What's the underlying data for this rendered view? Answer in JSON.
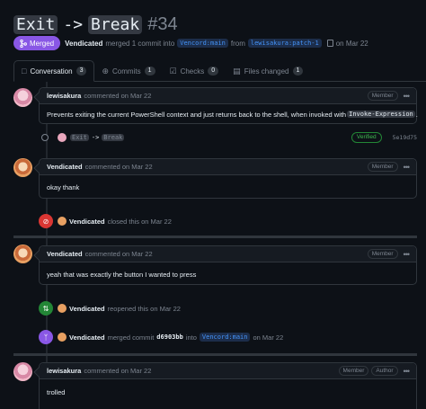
{
  "title": {
    "from": "Exit",
    "arrow": "->",
    "to": "Break",
    "number": "#34"
  },
  "state": {
    "badge": "Merged",
    "author": "Vendicated",
    "text1": "merged 1 commit into",
    "base": "Vencord:main",
    "text2": "from",
    "head": "lewisakura:patch-1",
    "date": "on Mar 22"
  },
  "tabs": [
    {
      "label": "Conversation",
      "count": "3",
      "icon": "comment-icon"
    },
    {
      "label": "Commits",
      "count": "1",
      "icon": "commit-icon"
    },
    {
      "label": "Checks",
      "count": "0",
      "icon": "checks-icon"
    },
    {
      "label": "Files changed",
      "count": "1",
      "icon": "file-diff-icon"
    }
  ],
  "comments": [
    {
      "author": "lewisakura",
      "meta": "commented on Mar 22",
      "roles": [
        "Member"
      ],
      "body_pre": "Prevents exiting the current PowerShell context and just returns back to the shell, when invoked with",
      "body_code": "Invoke-Expression",
      "body_post": "."
    },
    {
      "author": "Vendicated",
      "meta": "commented on Mar 22",
      "roles": [
        "Member"
      ],
      "body": "okay thank"
    },
    {
      "author": "Vendicated",
      "meta": "commented on Mar 22",
      "roles": [
        "Member"
      ],
      "body": "yeah that was exactly the button I wanted to press"
    },
    {
      "author": "lewisakura",
      "meta": "commented on Mar 22",
      "roles": [
        "Member",
        "Author"
      ],
      "body": "trolled"
    }
  ],
  "commit": {
    "from": "Exit",
    "arrow": "->",
    "to": "Break",
    "verified": "Verified",
    "sha": "5e19d75"
  },
  "events": {
    "closed": {
      "author": "Vendicated",
      "text": "closed this on Mar 22"
    },
    "reopened": {
      "author": "Vendicated",
      "text": "reopened this on Mar 22"
    },
    "merged": {
      "author": "Vendicated",
      "text1": "merged commit",
      "sha": "d6903bb",
      "text2": "into",
      "base": "Vencord:main",
      "text3": "on Mar 22"
    }
  },
  "colors": {
    "merged": "#8957e5",
    "closed": "#da3633",
    "reopened": "#238636",
    "link": "#4493f8"
  }
}
